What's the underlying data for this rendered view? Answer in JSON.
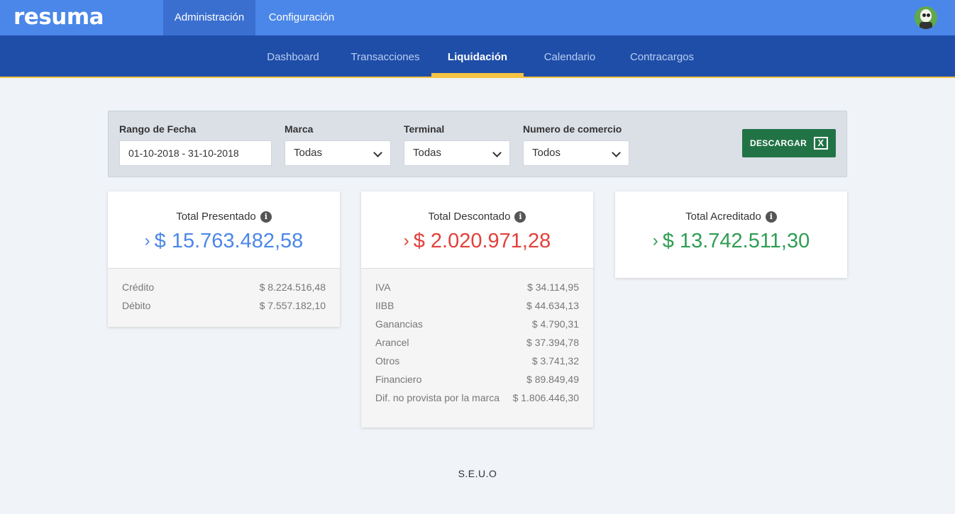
{
  "app": {
    "logo": "resuma"
  },
  "topnav": [
    {
      "label": "Administración",
      "active": true
    },
    {
      "label": "Configuración",
      "active": false
    }
  ],
  "subnav": [
    {
      "label": "Dashboard"
    },
    {
      "label": "Transacciones"
    },
    {
      "label": "Liquidación",
      "active": true
    },
    {
      "label": "Calendario"
    },
    {
      "label": "Contracargos"
    }
  ],
  "filters": {
    "date_label": "Rango de Fecha",
    "date_value": "01-10-2018 - 31-10-2018",
    "brand_label": "Marca",
    "brand_value": "Todas",
    "terminal_label": "Terminal",
    "terminal_value": "Todas",
    "merchant_label": "Numero de comercio",
    "merchant_value": "Todos",
    "download_label": "DESCARGAR",
    "download_icon": "X"
  },
  "cards": [
    {
      "title": "Total Presentado",
      "amount": "$ 15.763.482,58",
      "color": "#4b87e8",
      "rows": [
        {
          "label": "Crédito",
          "value": "$ 8.224.516,48"
        },
        {
          "label": "Débito",
          "value": "$ 7.557.182,10"
        }
      ]
    },
    {
      "title": "Total Descontado",
      "amount": "$ 2.020.971,28",
      "color": "#e2403b",
      "rows": [
        {
          "label": "IVA",
          "value": "$ 34.114,95"
        },
        {
          "label": "IIBB",
          "value": "$ 44.634,13"
        },
        {
          "label": "Ganancias",
          "value": "$ 4.790,31"
        },
        {
          "label": "Arancel",
          "value": "$ 37.394,78"
        },
        {
          "label": "Otros",
          "value": "$ 3.741,32"
        },
        {
          "label": "Financiero",
          "value": "$ 89.849,49"
        },
        {
          "label": "Dif. no provista por la marca",
          "value": "$ 1.806.446,30"
        }
      ]
    },
    {
      "title": "Total Acreditado",
      "amount": "$ 13.742.511,30",
      "color": "#2e9e52",
      "rows": []
    }
  ],
  "icons": {
    "info": "i",
    "arrow": "›"
  },
  "footer": {
    "text": "S.E.U.O"
  }
}
